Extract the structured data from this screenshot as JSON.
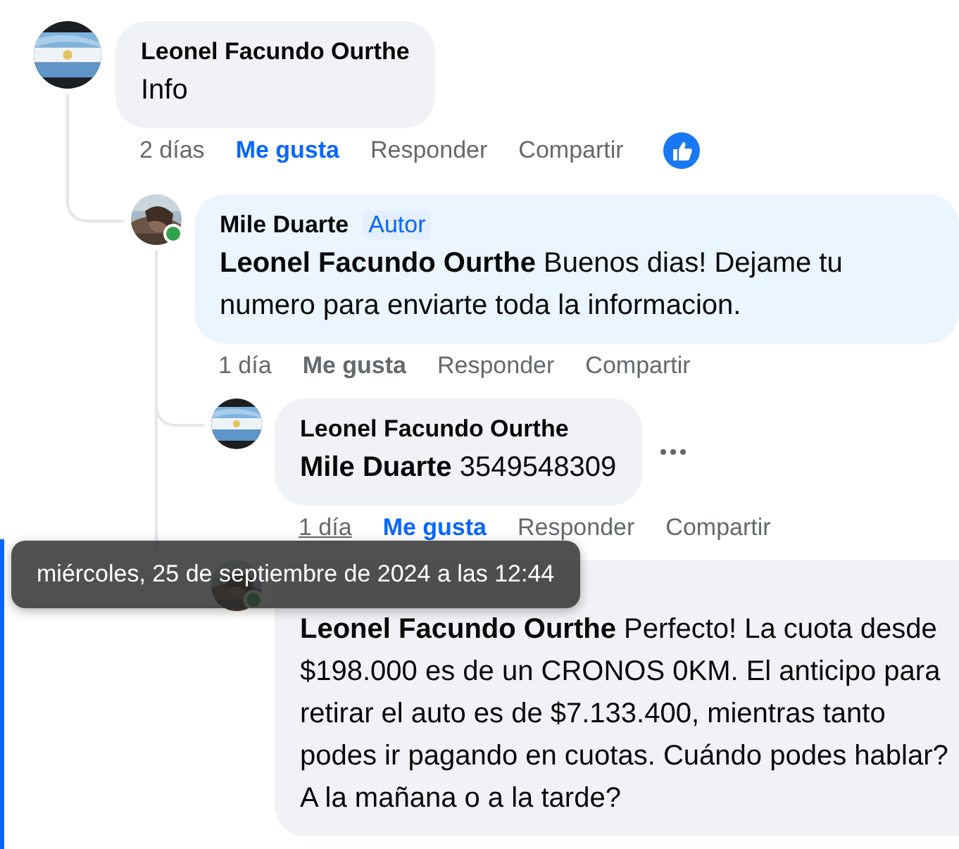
{
  "comments": [
    {
      "author": "Leonel Facundo Ourthe",
      "online": false,
      "highlighted": false,
      "more_menu": false,
      "avatar": {
        "kind": "picture"
      },
      "text": "Info",
      "actions": {
        "time": "2 días",
        "time_hovered": false,
        "like": "Me gusta",
        "liked": true,
        "reply": "Responder",
        "share": "Compartir",
        "reacted": true
      },
      "children": [
        {
          "author": "Mile Duarte",
          "badge": "Autor",
          "online": true,
          "highlighted": false,
          "more_menu": false,
          "avatar": {
            "kind": "picture"
          },
          "text": "**Leonel Facundo Ourthe** Buenos dias! Dejame tu numero para enviarte toda la informacion.",
          "actions": {
            "time": "1 día",
            "time_hovered": false,
            "like": "Me gusta",
            "liked": false,
            "reply": "Responder",
            "share": "Compartir",
            "reacted": false
          },
          "children": [
            {
              "author": "Leonel Facundo Ourthe",
              "online": false,
              "highlighted": false,
              "more_menu": true,
              "avatar": {
                "kind": "picture"
              },
              "text": "**Mile Duarte** 3549548309",
              "actions": {
                "time": "1 día",
                "time_hovered": true,
                "like": "Me gusta",
                "liked": true,
                "reply": "Responder",
                "share": "Compartir",
                "reacted": false
              }
            },
            {
              "online": true,
              "highlighted": true,
              "more_menu": false,
              "avatar": {
                "kind": "picture"
              },
              "text": "**Leonel Facundo Ourthe** Perfecto! La cuota desde $198.000 es de un CRONOS 0KM. El anticipo para retirar el auto es de $7.133.400, mientras tanto podes ir pagando en cuotas. Cuándo podes hablar? A la mañana o a la tarde?"
            }
          ]
        }
      ]
    }
  ],
  "tooltip": {
    "text": "miércoles, 25 de septiembre de 2024 a las 12:44"
  }
}
